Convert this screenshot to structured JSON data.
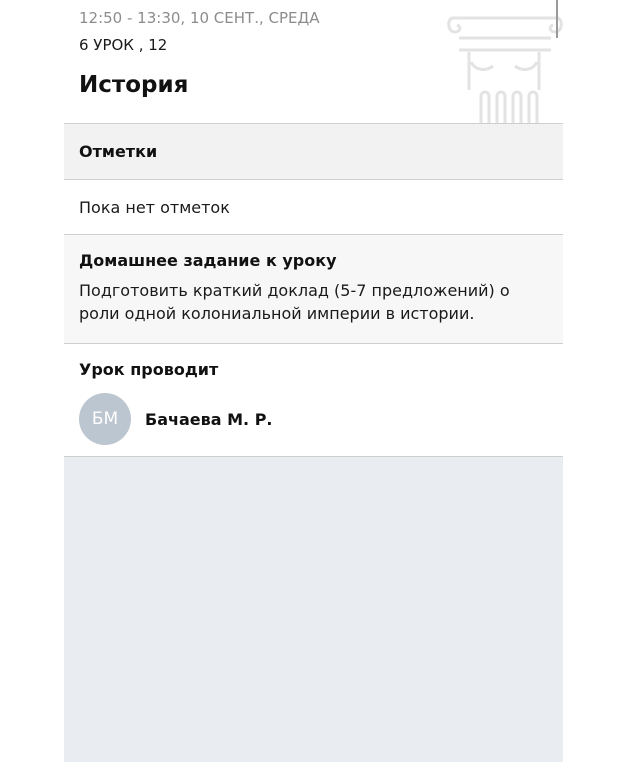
{
  "header": {
    "time_text": "12:50 - 13:30, 10 СЕНТ., СРЕДА",
    "lesson_text": "6 УРОК , 12",
    "subject": "История"
  },
  "grades": {
    "title": "Отметки",
    "empty_text": "Пока нет отметок"
  },
  "homework": {
    "title": "Домашнее задание к уроку",
    "text": "Подготовить краткий доклад (5-7 предложений) о роли одной колониальной империи в истории."
  },
  "teacher": {
    "title": "Урок проводит",
    "initials": "БМ",
    "name": "Бачаева М. Р."
  },
  "colors": {
    "background_area": "#e9edf1",
    "avatar": "#bcc6d0",
    "muted_text": "#8c8c8c"
  },
  "icons": {
    "subject_icon": "classical-column-icon"
  }
}
